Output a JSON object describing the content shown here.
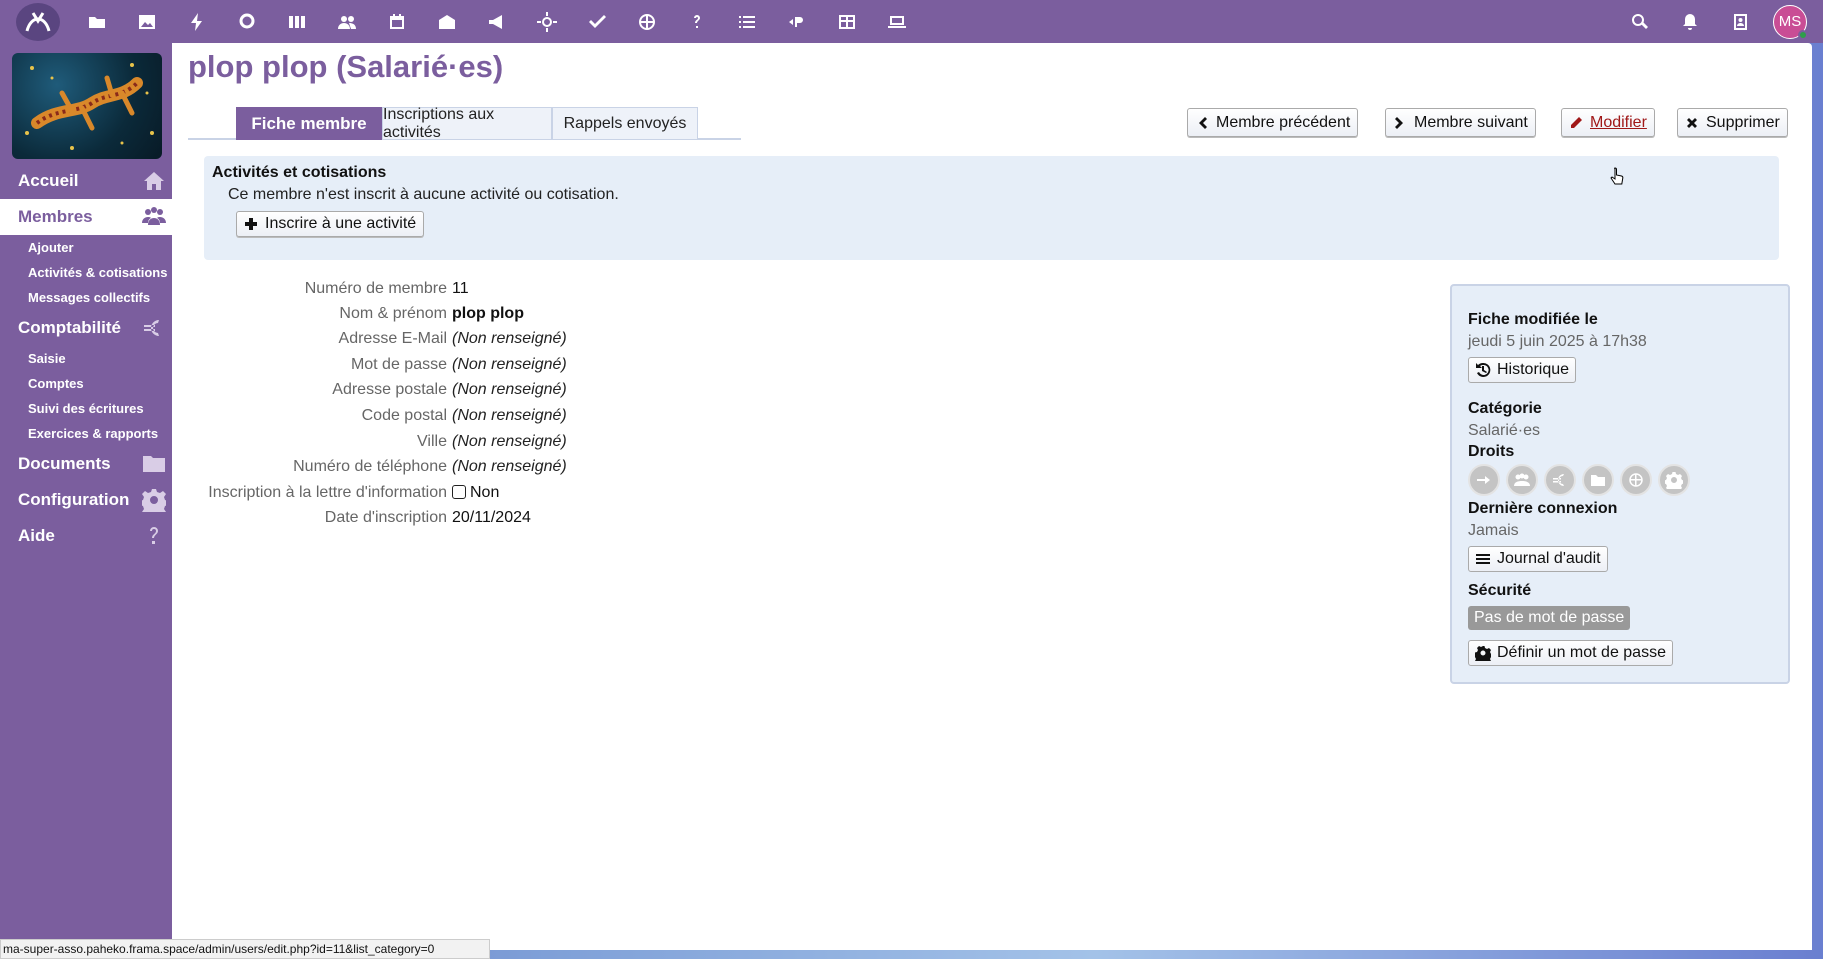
{
  "topbar": {
    "apps": [
      "files-icon",
      "photos-icon",
      "activity-icon",
      "search-talk-icon",
      "deck-icon",
      "contacts-icon",
      "calendar-icon",
      "archive-icon",
      "announcements-icon",
      "sun-icon",
      "tasks-icon",
      "globe-icon",
      "help-icon",
      "list-icon",
      "paheko-icon",
      "tables-icon",
      "laptop-icon"
    ],
    "right": [
      "search-icon",
      "notifications-icon",
      "contacts-menu-icon"
    ],
    "avatar_initials": "MS"
  },
  "sidebar": {
    "items": [
      {
        "label": "Accueil",
        "icon": "home-icon",
        "active": false
      },
      {
        "label": "Membres",
        "icon": "users-icon",
        "active": true,
        "sub": [
          "Ajouter",
          "Activités & cotisations",
          "Messages collectifs"
        ]
      },
      {
        "label": "Comptabilité",
        "icon": "euro-icon",
        "active": false,
        "sub": [
          "Saisie",
          "Comptes",
          "Suivi des écritures",
          "Exercices & rapports"
        ]
      },
      {
        "label": "Documents",
        "icon": "folder-icon",
        "active": false
      },
      {
        "label": "Configuration",
        "icon": "gear-icon",
        "active": false
      },
      {
        "label": "Aide",
        "icon": "help-icon",
        "active": false
      }
    ]
  },
  "page": {
    "title": "plop plop (Salarié·es)",
    "tabs": [
      "Fiche membre",
      "Inscriptions aux activités",
      "Rappels envoyés"
    ],
    "actions": {
      "previous": "Membre précédent",
      "next": "Membre suivant",
      "edit": "Modifier",
      "delete": "Supprimer"
    }
  },
  "activities": {
    "title": "Activités et cotisations",
    "message": "Ce membre n'est inscrit à aucune activité ou cotisation.",
    "button": "Inscrire à une activité"
  },
  "details": [
    {
      "label": "Numéro de membre",
      "value": "11",
      "style": ""
    },
    {
      "label": "Nom & prénom",
      "value": "plop plop",
      "style": "bold"
    },
    {
      "label": "Adresse E-Mail",
      "value": "(Non renseigné)",
      "style": "empty"
    },
    {
      "label": "Mot de passe",
      "value": "(Non renseigné)",
      "style": "empty"
    },
    {
      "label": "Adresse postale",
      "value": "(Non renseigné)",
      "style": "empty"
    },
    {
      "label": "Code postal",
      "value": "(Non renseigné)",
      "style": "empty"
    },
    {
      "label": "Ville",
      "value": "(Non renseigné)",
      "style": "empty"
    },
    {
      "label": "Numéro de téléphone",
      "value": "(Non renseigné)",
      "style": "empty"
    },
    {
      "label": "Inscription à la lettre d'information",
      "value": "Non",
      "style": "checkbox"
    },
    {
      "label": "Date d'inscription",
      "value": "20/11/2024",
      "style": ""
    }
  ],
  "info": {
    "modified_heading": "Fiche modifiée le",
    "modified_date": "jeudi 5 juin 2025 à 17h38",
    "history_button": "Historique",
    "category_heading": "Catégorie",
    "category_value": "Salarié·es",
    "rights_heading": "Droits",
    "rights_icons": [
      "login-icon",
      "users-icon",
      "euro-icon",
      "folder-icon",
      "web-icon",
      "gear-icon"
    ],
    "last_login_heading": "Dernière connexion",
    "last_login_value": "Jamais",
    "audit_button": "Journal d'audit",
    "security_heading": "Sécurité",
    "security_badge": "Pas de mot de passe",
    "set_password_button": "Définir un mot de passe"
  },
  "statusbar": {
    "url": "ma-super-asso.paheko.frama.space/admin/users/edit.php?id=11&list_category=0"
  }
}
